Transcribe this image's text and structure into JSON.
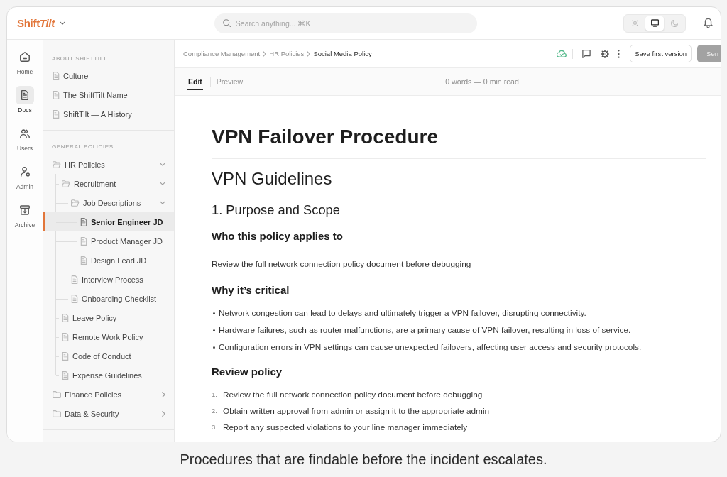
{
  "brand": {
    "logo_parts": [
      {
        "text": "Shift",
        "italic": false
      },
      {
        "text": "Tilt",
        "italic": true
      }
    ]
  },
  "search": {
    "placeholder": "Search anything... ⌘K"
  },
  "theme_modes": [
    {
      "kind": "light",
      "selected": false
    },
    {
      "kind": "system",
      "selected": true
    },
    {
      "kind": "dark",
      "selected": false
    }
  ],
  "rail": [
    {
      "label": "Home",
      "kind": "home",
      "selected": false
    },
    {
      "label": "Docs",
      "kind": "docs",
      "selected": true
    },
    {
      "label": "Users",
      "kind": "users",
      "selected": false
    },
    {
      "label": "Admin",
      "kind": "admin",
      "selected": false
    },
    {
      "label": "Archive",
      "kind": "archive",
      "selected": false
    }
  ],
  "sidebar": {
    "sections": [
      {
        "title": "ABOUT SHIFTTILT",
        "items": [
          {
            "label": "Culture",
            "kind": "doc",
            "selected": false
          },
          {
            "label": "The ShiftTilt Name",
            "kind": "doc",
            "selected": false
          },
          {
            "label": "ShiftTilt — A History",
            "kind": "doc",
            "selected": false
          }
        ]
      },
      {
        "title": "GENERAL POLICIES",
        "items": [
          {
            "label": "HR Policies",
            "kind": "folder",
            "expanded": true,
            "selected": false,
            "children": [
              {
                "label": "Recruitment",
                "kind": "folder",
                "expanded": true,
                "selected": false,
                "children": [
                  {
                    "label": "Job Descriptions",
                    "kind": "folder",
                    "expanded": true,
                    "selected": false,
                    "children": [
                      {
                        "label": "Senior Engineer JD",
                        "kind": "doc",
                        "selected": true
                      },
                      {
                        "label": "Product Manager JD",
                        "kind": "doc",
                        "selected": false
                      },
                      {
                        "label": "Design Lead JD",
                        "kind": "doc",
                        "selected": false
                      }
                    ]
                  },
                  {
                    "label": "Interview Process",
                    "kind": "doc",
                    "selected": false
                  },
                  {
                    "label": "Onboarding Checklist",
                    "kind": "doc",
                    "selected": false
                  }
                ]
              },
              {
                "label": "Leave Policy",
                "kind": "doc",
                "selected": false
              },
              {
                "label": "Remote Work Policy",
                "kind": "doc",
                "selected": false
              },
              {
                "label": "Code of Conduct",
                "kind": "doc",
                "selected": false
              },
              {
                "label": "Expense Guidelines",
                "kind": "doc",
                "selected": false
              }
            ]
          },
          {
            "label": "Finance Policies",
            "kind": "folder",
            "expanded": false,
            "selected": false
          },
          {
            "label": "Data & Security",
            "kind": "folder",
            "expanded": false,
            "selected": false
          }
        ]
      }
    ]
  },
  "breadcrumb": [
    {
      "label": "Compliance Management",
      "current": false
    },
    {
      "label": "HR Policies",
      "current": false
    },
    {
      "label": "Social Media Policy",
      "current": true
    }
  ],
  "actions": [
    {
      "label": "Save first version",
      "kind": "secondary",
      "disabled": false
    },
    {
      "label": "Sen",
      "kind": "primary",
      "disabled": true
    }
  ],
  "editor_tabs": [
    {
      "label": "Edit",
      "selected": true
    },
    {
      "label": "Preview",
      "selected": false
    }
  ],
  "stats": "0 words — 0 min read",
  "document": {
    "title": "VPN Failover Procedure",
    "blocks": [
      {
        "kind": "h1",
        "text": "VPN Guidelines"
      },
      {
        "kind": "h2",
        "text": "1. Purpose and Scope"
      },
      {
        "kind": "h3",
        "text": "Who this policy applies to"
      },
      {
        "kind": "p",
        "text": "Review the full network connection policy document before debugging"
      },
      {
        "kind": "h3",
        "text": "Why it’s critical"
      },
      {
        "kind": "ul",
        "items": [
          {
            "text": "Network congestion can lead to delays and ultimately trigger a VPN failover, disrupting connectivity."
          },
          {
            "text": "Hardware failures, such as router malfunctions, are a primary cause of VPN failover, resulting in loss of service."
          },
          {
            "text": "Configuration errors in VPN settings can cause unexpected failovers, affecting user access and security protocols."
          }
        ]
      },
      {
        "kind": "h3",
        "text": "Review policy"
      },
      {
        "kind": "ol",
        "items": [
          {
            "number": "1.",
            "text": "Review the full network connection policy document before debugging"
          },
          {
            "number": "2.",
            "text": "Obtain written approval from admin or assign it to the appropriate admin"
          },
          {
            "number": "3.",
            "text": "Report any suspected violations to your line manager immediately"
          }
        ]
      }
    ]
  },
  "caption": "Procedures that are findable before the incident escalates."
}
